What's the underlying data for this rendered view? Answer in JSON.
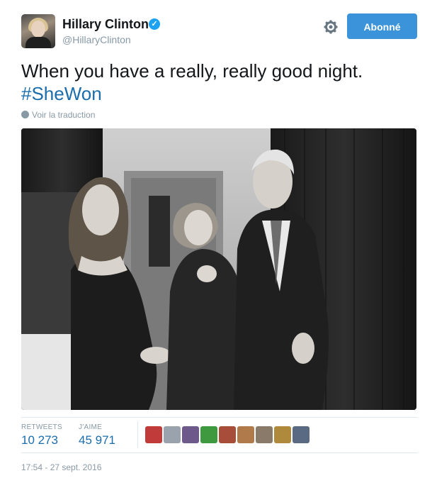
{
  "author": {
    "name": "Hillary Clinton",
    "handle": "@HillaryClinton",
    "verified": true
  },
  "actions": {
    "follow_label": "Abonné",
    "settings_icon": "gear-icon"
  },
  "tweet": {
    "text": "When you have a really, really good night.",
    "hashtag": "#SheWon",
    "translate_label": "Voir la traduction"
  },
  "stats": {
    "retweets_label": "RETWEETS",
    "retweets_value": "10 273",
    "likes_label": "J'AIME",
    "likes_value": "45 971"
  },
  "likers": [
    {
      "color": "#c23b3b"
    },
    {
      "color": "#9aa3ad"
    },
    {
      "color": "#6d5a8a"
    },
    {
      "color": "#3f9a3f"
    },
    {
      "color": "#a84d3a"
    },
    {
      "color": "#b07a4a"
    },
    {
      "color": "#8a7a6a"
    },
    {
      "color": "#b08a3c"
    },
    {
      "color": "#5a6a82"
    }
  ],
  "timestamp": "17:54 - 27 sept. 2016",
  "colors": {
    "accent": "#3b94d9",
    "link": "#1b6dac",
    "muted": "#8899a6"
  }
}
